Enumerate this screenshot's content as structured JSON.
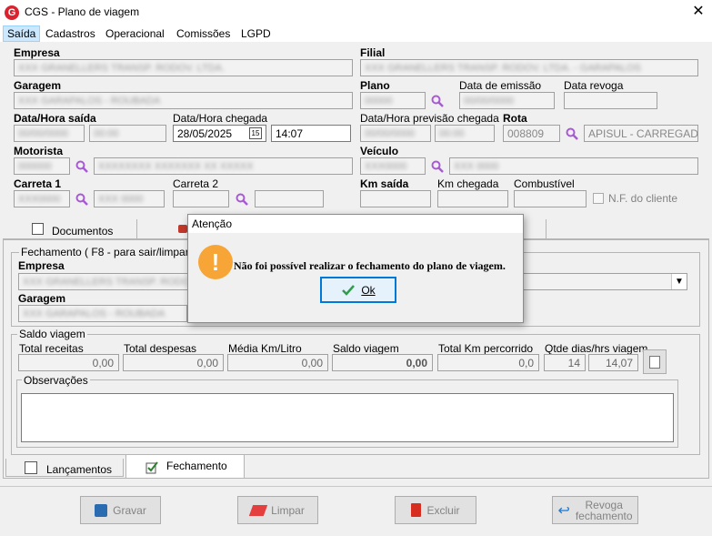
{
  "window": {
    "title": "CGS - Plano de viagem"
  },
  "menu": [
    {
      "label": "Saída",
      "active": true
    },
    {
      "label": "Cadastros"
    },
    {
      "label": "Operacional"
    },
    {
      "label": "Comissões"
    },
    {
      "label": "LGPD"
    }
  ],
  "header": {
    "empresa_label": "Empresa",
    "empresa_value": "XXX GRANELLERS TRANSP. RODOV. LTDA.",
    "filial_label": "Filial",
    "filial_value": "XXX GRANELLERS TRANSP. RODOV. LTDA. - GARAPALOS",
    "garagem_label": "Garagem",
    "garagem_value": "XXX GARAPALOS - ROUBADA",
    "plano_label": "Plano",
    "plano_value": "00000",
    "data_emissao_label": "Data de emissão",
    "data_emissao_value": "00/00/0000",
    "data_revoga_label": "Data revoga",
    "data_hora_saida_label": "Data/Hora saída",
    "data_saida_value": "00/00/0000",
    "hora_saida_value": "00:00",
    "data_hora_chegada_label": "Data/Hora chegada",
    "data_chegada_value": "28/05/2025",
    "hora_chegada_value": "14:07",
    "data_hora_previsao_label": "Data/Hora previsão chegada",
    "data_previsao_value": "00/00/0000",
    "hora_previsao_value": "00:00",
    "rota_label": "Rota",
    "rota_codigo": "008809",
    "rota_descricao": "APISUL - CARREGADO -",
    "motorista_label": "Motorista",
    "motorista_codigo": "000000",
    "motorista_nome": "XXXXXXXX XXXXXXX XX XXXXX",
    "veiculo_label": "Veículo",
    "veiculo_placa": "XXX0000",
    "veiculo_desc": "XXX 0000",
    "carreta1_label": "Carreta 1",
    "carreta1_placa": "XXX0000",
    "carreta1_desc": "XXX 0000",
    "carreta2_label": "Carreta 2",
    "km_saida_label": "Km saída",
    "km_chegada_label": "Km chegada",
    "combustivel_label": "Combustível",
    "nf_cliente_label": "N.F. do cliente"
  },
  "top_tabs": [
    {
      "label": "Documentos"
    },
    {
      "label": ""
    }
  ],
  "fechamento": {
    "group_title": "Fechamento ( F8 - para sair/limpar )",
    "empresa_label": "Empresa",
    "empresa_value": "XXX GRANELLERS TRANSP. RODOV.",
    "garagem_label": "Garagem",
    "garagem_value": "XXX GARAPALOS - ROUBADA"
  },
  "saldo": {
    "group_title": "Saldo viagem",
    "total_receitas_label": "Total receitas",
    "total_receitas_value": "0,00",
    "total_despesas_label": "Total despesas",
    "total_despesas_value": "0,00",
    "media_label": "Média Km/Litro",
    "media_value": "0,00",
    "saldo_label": "Saldo viagem",
    "saldo_value": "0,00",
    "km_percorrido_label": "Total Km percorrido",
    "km_percorrido_value": "0,0",
    "qtde_label": "Qtde dias/hrs viagem",
    "qtde_dias": "14",
    "qtde_hrs": "14,07"
  },
  "observacoes": {
    "label": "Observações",
    "value": ""
  },
  "bottom_tabs": [
    {
      "label": "Lançamentos"
    },
    {
      "label": "Fechamento"
    }
  ],
  "buttons": {
    "gravar": "Gravar",
    "limpar": "Limpar",
    "excluir": "Excluir",
    "revoga_line1": "Revoga",
    "revoga_line2": "fechamento"
  },
  "dialog": {
    "title": "Atenção",
    "message": "Não foi possível realizar o fechamento do plano de viagem.",
    "ok_label": "Ok"
  },
  "colors": {
    "accent": "#0078d7",
    "warning": "#f7a536",
    "search_icon": "#a85ad4",
    "brand": "#d9232e"
  }
}
